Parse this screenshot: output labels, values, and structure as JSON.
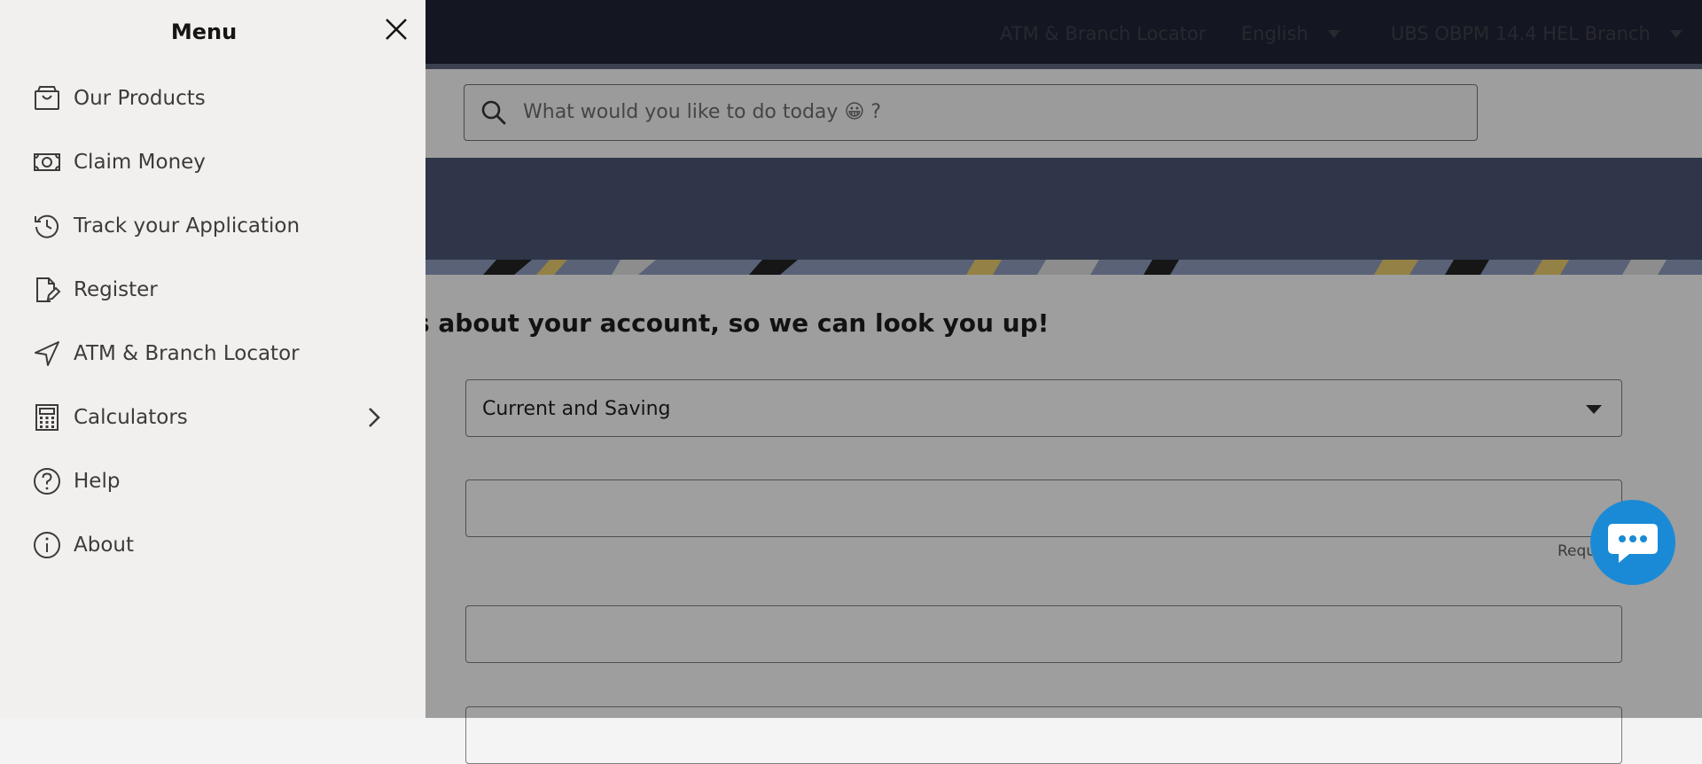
{
  "header": {
    "atm_link": "ATM & Branch Locator",
    "language": "English",
    "branch": "UBS OBPM 14.4 HEL Branch"
  },
  "search": {
    "placeholder": "What would you like to do today 😀 ?"
  },
  "form": {
    "heading": "s about your account, so we can look you up!",
    "account_type": "Current and Saving",
    "required_hint": "Requ"
  },
  "drawer": {
    "title": "Menu",
    "items": [
      {
        "label": "Our Products",
        "icon": "shopping-bag-icon"
      },
      {
        "label": "Claim Money",
        "icon": "banknote-icon"
      },
      {
        "label": "Track your Application",
        "icon": "history-icon"
      },
      {
        "label": "Register",
        "icon": "document-edit-icon"
      },
      {
        "label": "ATM & Branch Locator",
        "icon": "navigation-arrow-icon"
      },
      {
        "label": "Calculators",
        "icon": "calculator-icon"
      },
      {
        "label": "Help",
        "icon": "help-circle-icon"
      },
      {
        "label": "About",
        "icon": "info-circle-icon"
      }
    ]
  },
  "colors": {
    "topbar": "#1f2433",
    "banner": "#4b5370",
    "drawer_bg": "#f1f0ee",
    "chat_button": "#1b8ad6"
  }
}
